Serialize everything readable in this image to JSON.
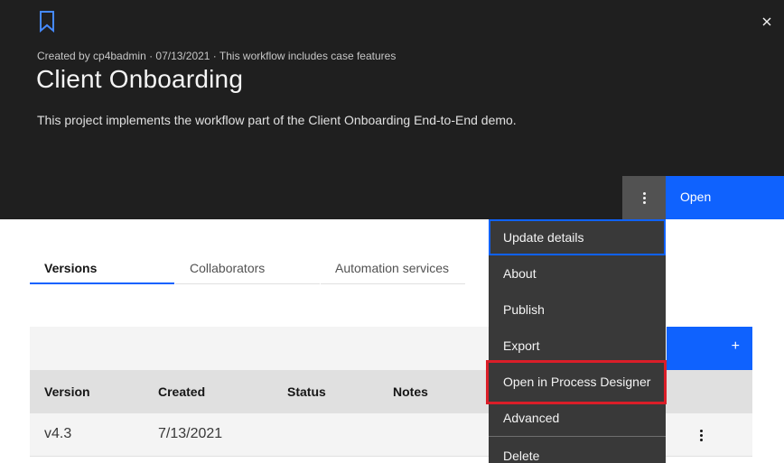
{
  "header": {
    "meta": "Created by cp4badmin · 07/13/2021 · This workflow includes case features",
    "title": "Client Onboarding",
    "description": "This project implements the workflow part of the Client Onboarding End-to-End demo.",
    "open_label": "Open"
  },
  "tabs": [
    {
      "label": "Versions",
      "active": true
    },
    {
      "label": "Collaborators",
      "active": false
    },
    {
      "label": "Automation services",
      "active": false
    }
  ],
  "toolbar": {
    "add_label": "+"
  },
  "table": {
    "columns": [
      "Version",
      "Created",
      "Status",
      "Notes"
    ],
    "rows": [
      {
        "version": "v4.3",
        "created": "7/13/2021",
        "status": "",
        "notes": ""
      }
    ]
  },
  "menu": {
    "items": [
      {
        "label": "Update details"
      },
      {
        "label": "About"
      },
      {
        "label": "Publish"
      },
      {
        "label": "Export"
      },
      {
        "label": "Open in Process Designer"
      },
      {
        "label": "Advanced"
      },
      {
        "label": "Delete"
      }
    ]
  },
  "colors": {
    "header_bg": "#1f1f1f",
    "primary": "#0f62fe",
    "menu_bg": "#393939",
    "highlight": "#da1e28"
  },
  "icons": [
    "bookmark-icon",
    "close-icon",
    "overflow-menu-icon",
    "add-icon"
  ]
}
